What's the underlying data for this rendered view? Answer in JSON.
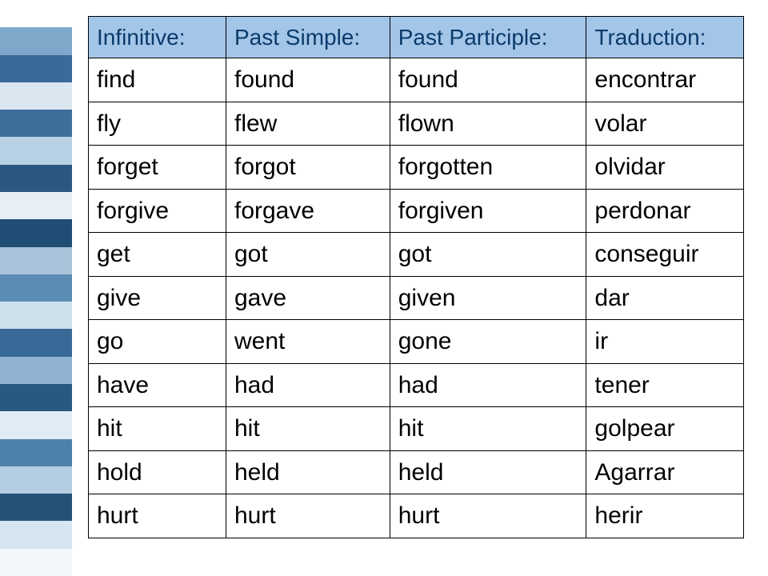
{
  "stripes": [
    "#ffffff",
    "#7da8c9",
    "#3a6a99",
    "#dbe7f0",
    "#3e6f9b",
    "#b9d1e4",
    "#2c5880",
    "#e7eff6",
    "#1f4d73",
    "#a8c3da",
    "#5b8cb4",
    "#cfe0ed",
    "#396a97",
    "#8fb3d1",
    "#2a597f",
    "#e0ebf3",
    "#4d80aa",
    "#b3cee2",
    "#265176",
    "#d6e5f1",
    "#f2f7fb"
  ],
  "table": {
    "headers": [
      "Infinitive:",
      "Past Simple:",
      "Past Participle:",
      "Traduction:"
    ],
    "rows": [
      [
        "find",
        "found",
        "found",
        "encontrar"
      ],
      [
        "fly",
        "flew",
        "flown",
        "volar"
      ],
      [
        "forget",
        "forgot",
        "forgotten",
        "olvidar"
      ],
      [
        "forgive",
        "forgave",
        "forgiven",
        "perdonar"
      ],
      [
        "get",
        "got",
        "got",
        "conseguir"
      ],
      [
        "give",
        "gave",
        "given",
        "dar"
      ],
      [
        "go",
        "went",
        "gone",
        "ir"
      ],
      [
        "have",
        "had",
        "had",
        "tener"
      ],
      [
        "hit",
        "hit",
        "hit",
        "golpear"
      ],
      [
        "hold",
        "held",
        "held",
        "Agarrar"
      ],
      [
        "hurt",
        "hurt",
        "hurt",
        "herir"
      ]
    ]
  },
  "chart_data": {
    "type": "table",
    "title": "Irregular verbs — Infinitive / Past Simple / Past Participle / Traduction",
    "columns": [
      "Infinitive",
      "Past Simple",
      "Past Participle",
      "Traduction"
    ],
    "rows": [
      {
        "Infinitive": "find",
        "Past Simple": "found",
        "Past Participle": "found",
        "Traduction": "encontrar"
      },
      {
        "Infinitive": "fly",
        "Past Simple": "flew",
        "Past Participle": "flown",
        "Traduction": "volar"
      },
      {
        "Infinitive": "forget",
        "Past Simple": "forgot",
        "Past Participle": "forgotten",
        "Traduction": "olvidar"
      },
      {
        "Infinitive": "forgive",
        "Past Simple": "forgave",
        "Past Participle": "forgiven",
        "Traduction": "perdonar"
      },
      {
        "Infinitive": "get",
        "Past Simple": "got",
        "Past Participle": "got",
        "Traduction": "conseguir"
      },
      {
        "Infinitive": "give",
        "Past Simple": "gave",
        "Past Participle": "given",
        "Traduction": "dar"
      },
      {
        "Infinitive": "go",
        "Past Simple": "went",
        "Past Participle": "gone",
        "Traduction": "ir"
      },
      {
        "Infinitive": "have",
        "Past Simple": "had",
        "Past Participle": "had",
        "Traduction": "tener"
      },
      {
        "Infinitive": "hit",
        "Past Simple": "hit",
        "Past Participle": "hit",
        "Traduction": "golpear"
      },
      {
        "Infinitive": "hold",
        "Past Simple": "held",
        "Past Participle": "held",
        "Traduction": "Agarrar"
      },
      {
        "Infinitive": "hurt",
        "Past Simple": "hurt",
        "Past Participle": "hurt",
        "Traduction": "herir"
      }
    ]
  }
}
